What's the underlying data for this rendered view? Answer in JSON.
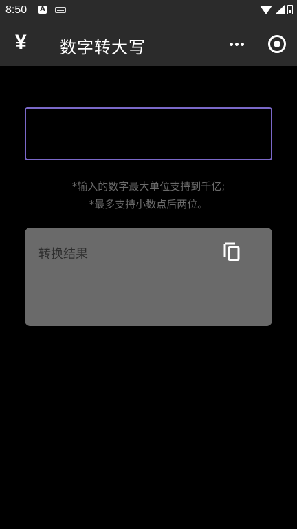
{
  "status_bar": {
    "time": "8:50",
    "a_badge": "A"
  },
  "nav": {
    "logo_glyph": "¥",
    "title": "数字转大写"
  },
  "converter": {
    "input_value": "",
    "input_placeholder": "",
    "hint_line1": "*输入的数字最大单位支持到千亿;",
    "hint_line2": "*最多支持小数点后两位。",
    "result_label": "转换结果"
  },
  "colors": {
    "accent_border": "#7a68c8",
    "card_bg": "#6a6a6a",
    "nav_bg": "#2b2b2b"
  }
}
